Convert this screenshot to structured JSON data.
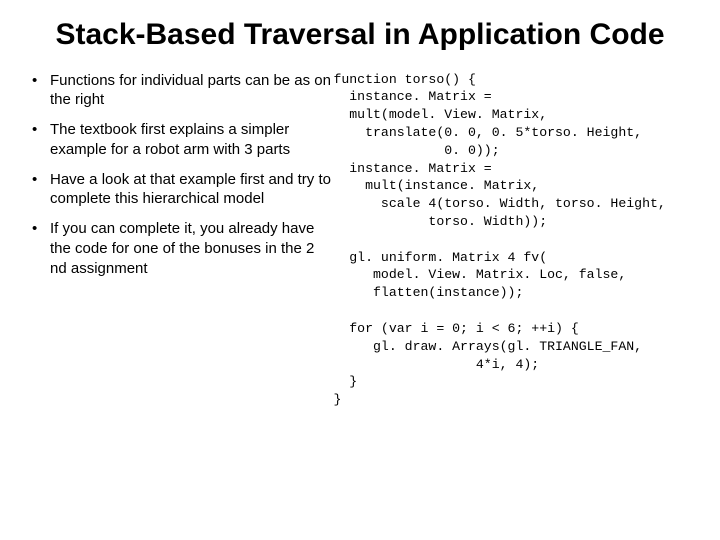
{
  "title": "Stack-Based Traversal in Application Code",
  "bullets": [
    "Functions for individual parts can be as on the right",
    "The textbook first explains a simpler example for a robot arm with 3 parts",
    "Have a look at that example first and try to complete this hierarchical model",
    "If you can complete it, you already have the code for one of the bonuses in the 2 nd assignment"
  ],
  "code": "function torso() {\n  instance. Matrix =\n  mult(model. View. Matrix,\n    translate(0. 0, 0. 5*torso. Height,\n              0. 0));\n  instance. Matrix =\n    mult(instance. Matrix,\n      scale 4(torso. Width, torso. Height,\n            torso. Width));\n\n  gl. uniform. Matrix 4 fv(\n     model. View. Matrix. Loc, false,\n     flatten(instance));\n\n  for (var i = 0; i < 6; ++i) {\n     gl. draw. Arrays(gl. TRIANGLE_FAN,\n                  4*i, 4);\n  }\n}"
}
